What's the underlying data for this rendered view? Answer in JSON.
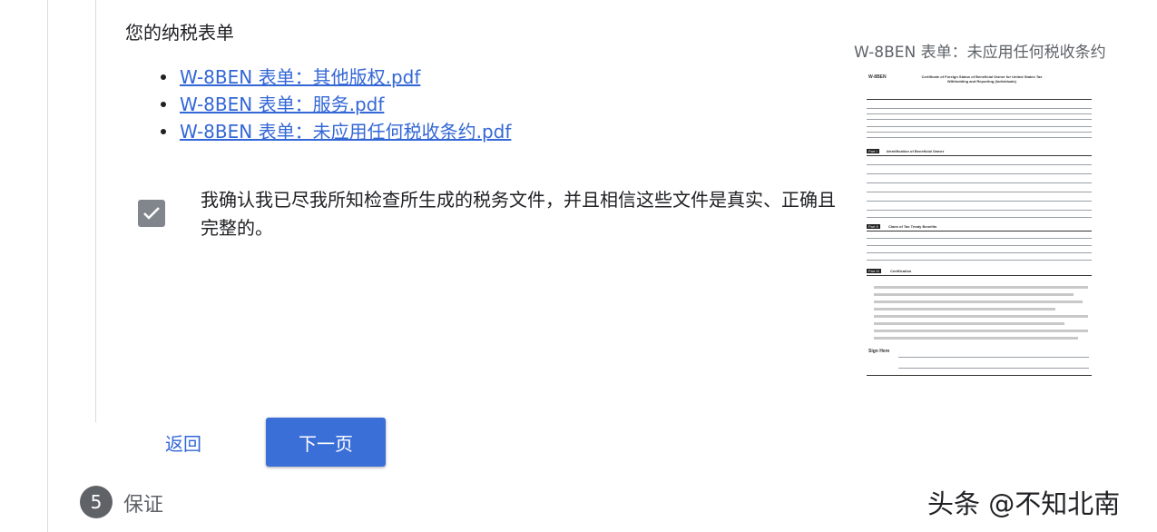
{
  "section": {
    "title": "您的纳税表单"
  },
  "documents": [
    {
      "label": "W-8BEN 表单：其他版权.pdf"
    },
    {
      "label": "W-8BEN 表单：服务.pdf"
    },
    {
      "label": "W-8BEN 表单：未应用任何税收条约.pdf"
    }
  ],
  "confirmation": {
    "checked": true,
    "text": "我确认我已尽我所知检查所生成的税务文件，并且相信这些文件是真实、正确且完整的。"
  },
  "preview": {
    "title": "W-8BEN 表单：未应用任何税收条约",
    "form_number": "W-8BEN",
    "form_heading": "Certificate of Foreign Status of Beneficial Owner for United States Tax Withholding and Reporting (Individuals)",
    "parts": [
      "Part I",
      "Part II",
      "Part III"
    ],
    "part_titles": [
      "Identification of Beneficial Owner",
      "Claim of Tax Treaty Benefits",
      "Certification"
    ],
    "sign_here": "Sign Here"
  },
  "actions": {
    "back_label": "返回",
    "next_label": "下一页"
  },
  "step": {
    "number": "5",
    "label": "保证"
  },
  "watermark": "头条 @不知北南",
  "colors": {
    "link": "#3367d6",
    "primary_button": "#3b6fd8",
    "checkbox": "#80868b",
    "step_circle": "#5f6368"
  }
}
